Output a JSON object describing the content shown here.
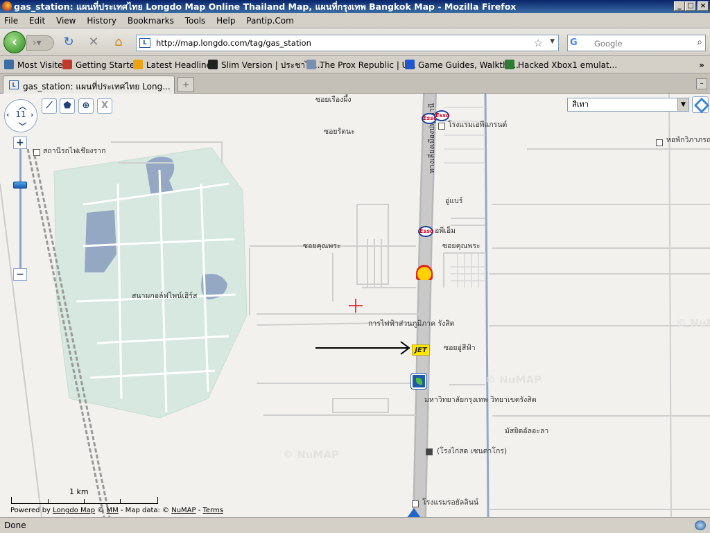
{
  "window": {
    "title": "gas_station: แผนที่ประเทศไทย Longdo Map Online Thailand Map, แผนที่กรุงเทพ Bangkok Map - Mozilla Firefox"
  },
  "menu": [
    "File",
    "Edit",
    "View",
    "History",
    "Bookmarks",
    "Tools",
    "Help",
    "Pantip.Com"
  ],
  "nav": {
    "url": "http://map.longdo.com/tag/gas_station",
    "search_placeholder": "Google"
  },
  "bookmarks": [
    {
      "label": "Most Visited",
      "icon": "folder-icon",
      "color": "#3a6ea5"
    },
    {
      "label": "Getting Started",
      "icon": "firefox-icon",
      "color": "#c0392b"
    },
    {
      "label": "Latest Headlines",
      "icon": "rss-icon",
      "color": "#e8a317"
    },
    {
      "label": "Slim Version | ประชาไท...",
      "icon": "rss-icon",
      "color": "#222222"
    },
    {
      "label": "The Prox Republic | U...",
      "icon": "page-icon",
      "color": "#7a8fb0"
    },
    {
      "label": "Game Guides, Walkthr...",
      "icon": "g-icon",
      "color": "#2255cc"
    },
    {
      "label": "Hacked Xbox1 emulat...",
      "icon": "seven-icon",
      "color": "#2e7d32"
    }
  ],
  "tab": {
    "label": "gas_station: แผนที่ประเทศไทย Long...",
    "favicon": "L"
  },
  "map": {
    "zoom": "11",
    "layer": "สีเทา",
    "scale_label": "1 km",
    "credit": {
      "prefix": "Powered by ",
      "longdo": "Longdo Map",
      "c1": " © ",
      "mm": "MM",
      "mid": " - Map data: © ",
      "numap": "NuMAP",
      "dash": " - ",
      "terms": "Terms"
    },
    "watermark": "© NuMAP",
    "labels": [
      "ซอยเรืองผึ้ง",
      "ซอยรัตนะ",
      "สถานีรถไฟเชียงราก",
      "โรงแรมเอพีแกรนด์",
      "หอพักวิภาภรณ์",
      "อู่แบร์",
      "อพีเอ็ม",
      "ซอยคุณพระ",
      "ซอยคุณพระ",
      "สนามกอล์ฟไพน์เฮิร์ส",
      "การไฟฟ้าส่วนภูมิภาค รังสิต",
      "ซอยอู่สีฟ้า",
      "มหาวิทยาลัยกรุงเทพ วิทยาเขตรังสิต",
      "มัสยิดอัลอะลา",
      "(โรงไก่สด เซนตาโกร)",
      "โรงแรมรอยัลลินน์",
      "ทางเลี่ยงเมืองปทุมธานี"
    ],
    "brands": {
      "esso": "Esso",
      "jet": "JET"
    }
  },
  "status": {
    "text": "Done"
  },
  "colors": {
    "titlebar": "#0a246a",
    "esso_red": "#d0021b",
    "jet_yellow": "#ffe600",
    "ptt_blue": "#1e5aa8",
    "road_gray": "#b8b8b8",
    "golf_green": "#d6e8e0",
    "water": "#94a8c4"
  }
}
